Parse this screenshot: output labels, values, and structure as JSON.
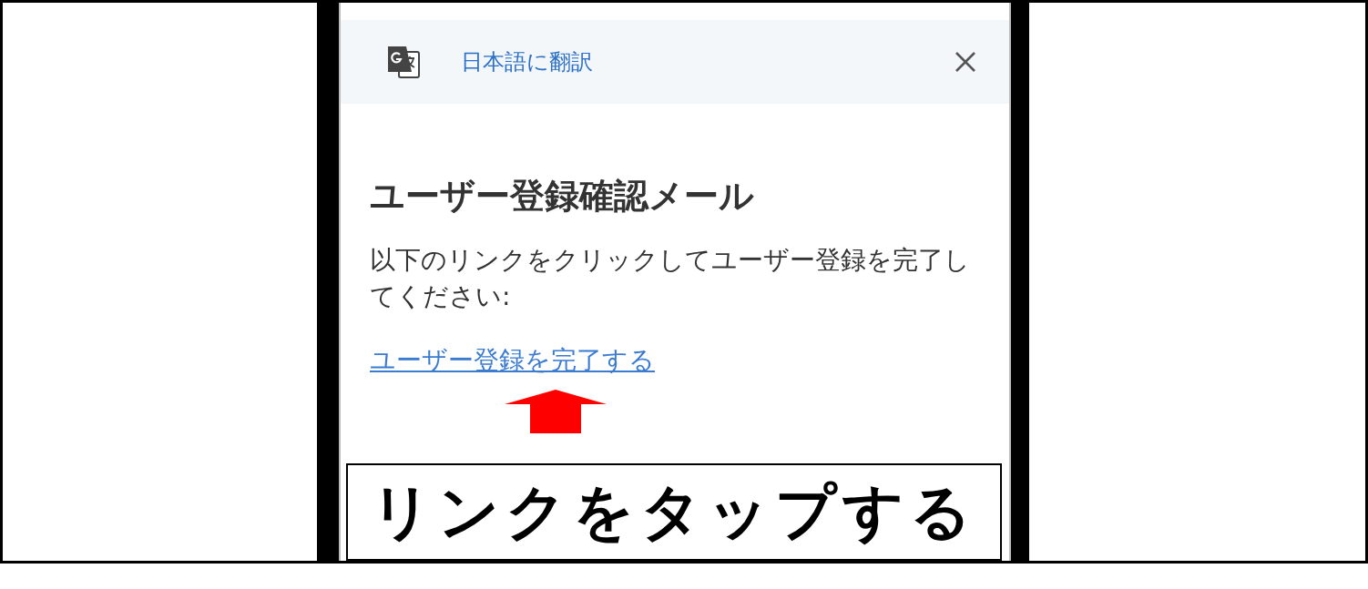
{
  "translate_bar": {
    "label": "日本語に翻訳"
  },
  "email": {
    "title": "ユーザー登録確認メール",
    "body": "以下のリンクをクリックしてユーザー登録を完了してください:",
    "link": "ユーザー登録を完了する"
  },
  "caption": "リンクをタップする"
}
